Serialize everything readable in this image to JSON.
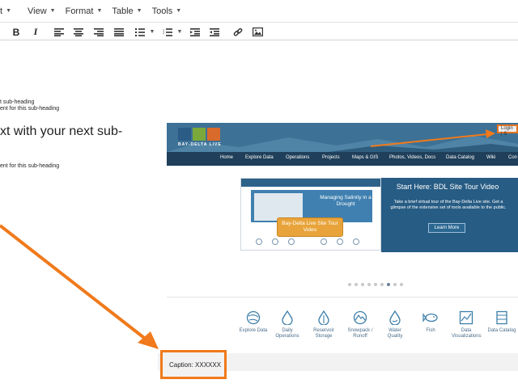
{
  "menu": {
    "partial": "t",
    "view": "View",
    "format": "Format",
    "table": "Table",
    "tools": "Tools"
  },
  "toolbar": {
    "bold": "B",
    "italic": "I"
  },
  "document": {
    "line1": "t sub-heading",
    "line2": "ent for this sub-heading",
    "heading": "xt with your next sub-",
    "line3": "ent for this sub-heading",
    "caption": "Caption: XXXXXX"
  },
  "site": {
    "logo_text": "BAY-DELTA LIVE",
    "login": "Login | S",
    "nav": [
      "Home",
      "Explore Data",
      "Operations",
      "Projects",
      "Maps & GIS",
      "Photos, Videos, Docs",
      "Data Catalog",
      "Wiki",
      "Con"
    ],
    "thumb_title": "Managing Salinity in a Drought",
    "thumb_button": "Bay-Delta Live Site Tour Video",
    "panel_title": "Start Here: BDL Site Tour Video",
    "panel_text": "Take a brief virtual tour of the Bay-Delta Live site. Get a glimpse of the extensive set of tools available to the public.",
    "learn_more": "Learn More",
    "icons": [
      {
        "label": "Explore Data",
        "icon": "globe-icon"
      },
      {
        "label": "Daily Operations",
        "icon": "drop-icon"
      },
      {
        "label": "Reservoir Storage",
        "icon": "reservoir-icon"
      },
      {
        "label": "Snowpack / Runoff",
        "icon": "mountain-icon"
      },
      {
        "label": "Water Quality",
        "icon": "water-quality-icon"
      },
      {
        "label": "Fish",
        "icon": "fish-icon"
      },
      {
        "label": "Data Visualizations",
        "icon": "chart-icon"
      },
      {
        "label": "Data Catalog",
        "icon": "catalog-icon"
      }
    ]
  },
  "colors": {
    "accent": "#f07a1c",
    "banner": "#3c6f93",
    "nav": "#1f3f5a",
    "panel": "#275c84"
  }
}
